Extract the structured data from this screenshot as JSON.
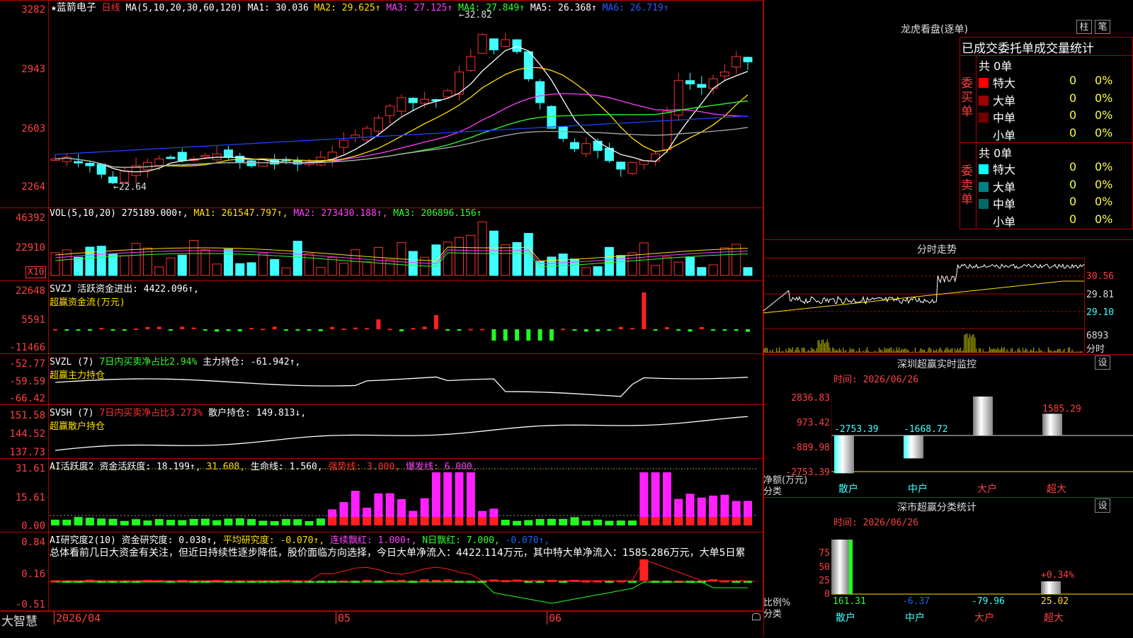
{
  "stock": {
    "star": "★",
    "name": "蓝箭电子",
    "period": "日线"
  },
  "main": {
    "ylabels": [
      "3282",
      "2943",
      "2603",
      "2264"
    ],
    "ma_header": {
      "params": "MA(5,10,20,30,60,120)",
      "ma1": "MA1: 30.036",
      "ma2": "MA2: 29.625↑",
      "ma3": "MA3: 27.125↑",
      "ma4": "MA4: 27.849↑",
      "ma5": "MA5: 26.368↑",
      "ma6": "MA6: 26.719↑"
    },
    "high_label": "32.82",
    "low_label": "22.64"
  },
  "vol": {
    "ylabels": [
      "46392",
      "22910"
    ],
    "unit": "X10",
    "header": {
      "p": "VOL(5,10,20)",
      "v": "275189.000↑,",
      "ma1": "MA1: 261547.797↑,",
      "ma2": "MA2: 273430.188↑,",
      "ma3": "MA3: 206896.156↑"
    }
  },
  "svzj": {
    "ylabels": [
      "22648",
      "5591",
      "-11466"
    ],
    "line1": "SVZJ  活跃资金进出: 4422.096↑,",
    "line2": "超赢资金流(万元)"
  },
  "svzl": {
    "ylabels": [
      "-52.77",
      "-59.59",
      "-66.42"
    ],
    "line1a": "SVZL (7)",
    "line1b": "7日内买卖净占比2.94%",
    "line1c": "主力持仓: -61.942↑,",
    "line2": "超赢主力持仓"
  },
  "svsh": {
    "ylabels": [
      "151.58",
      "144.52",
      "137.73"
    ],
    "line1a": "SVSH (7)",
    "line1b": "7日内买卖净占比3.273%",
    "line1c": "散户持仓: 149.813↓,",
    "line2": "超赢散户持仓"
  },
  "ai1": {
    "ylabels": [
      "31.61",
      "15.61",
      "0.00"
    ],
    "a": "AI活跃度2",
    "b": "资金活跃度: 18.199↑,",
    "c": "31.608,",
    "d": "生命线: 1.560,",
    "e": "强势线: 3.000,",
    "f": "爆发线: 6.000,"
  },
  "ai2": {
    "ylabels": [
      "0.84",
      "0.16",
      "-0.51"
    ],
    "a": "AI研究度2(10)",
    "b": "资金研究度: 0.038↑,",
    "c": "平均研究度: -0.070↑,",
    "d": "连续飘红: 1.000↑,",
    "e": "N日飘红: 7.000,",
    "f": "-0.070↑,",
    "summary": "总体看前几日大资金有关注，但近日持续性逐步降低，股价面临方向选择，今日大单净流入：4422.114万元，其中特大单净流入：1585.286万元，大单5日累"
  },
  "xaxis": {
    "start": "2026/04",
    "m05": "05",
    "m06": "06"
  },
  "brand": "大智慧",
  "right": {
    "lhb_title": "龙虎看盘(逐单)",
    "btn_zhu": "柱",
    "btn_bi": "笔",
    "stat_title": "已成交委托单成交量统计",
    "buy": {
      "vlabel": "委买单",
      "total": "共 0单",
      "rows": [
        {
          "name": "特大",
          "v": "0",
          "p": "0%",
          "color": "#ff0000"
        },
        {
          "name": "大单",
          "v": "0",
          "p": "0%",
          "color": "#a00000"
        },
        {
          "name": "中单",
          "v": "0",
          "p": "0%",
          "color": "#700000"
        },
        {
          "name": "小单",
          "v": "0",
          "p": "0%",
          "color": "#000000"
        }
      ]
    },
    "sell": {
      "vlabel": "委卖单",
      "total": "共 0单",
      "rows": [
        {
          "name": "特大",
          "v": "0",
          "p": "0%",
          "color": "#00ffff"
        },
        {
          "name": "大单",
          "v": "0",
          "p": "0%",
          "color": "#008080"
        },
        {
          "name": "中单",
          "v": "0",
          "p": "0%",
          "color": "#006868"
        },
        {
          "name": "小单",
          "v": "0",
          "p": "0%",
          "color": "#000000"
        }
      ]
    },
    "fenshi": {
      "title": "分时走势",
      "y1": "30.56",
      "y2": "29.81",
      "y3": "29.10",
      "vol": "6893",
      "unit": "分时"
    },
    "monitor": {
      "title": "深圳超赢实时监控",
      "set": "设",
      "time": "时间: 2026/06/26",
      "ylabels": [
        "2836.83",
        "973.42",
        "-889.98",
        "-2753.39"
      ],
      "label_net": "净额(万元)",
      "label_cat": "分类",
      "bars": [
        {
          "name": "散户",
          "value": "-2753.39"
        },
        {
          "name": "中户",
          "value": "-1668.72"
        },
        {
          "name": "大户",
          "value": "2836.83"
        },
        {
          "name": "超大",
          "value": "1585.29"
        }
      ]
    },
    "classify": {
      "title": "深市超赢分类统计",
      "set": "设",
      "time": "时间: 2026/06/26",
      "ylabels": [
        "75",
        "50",
        "25",
        "0"
      ],
      "label_ratio": "比例%",
      "label_cat": "分类",
      "vals": [
        "161.31",
        "-6.37",
        "-79.96",
        "25.02"
      ],
      "extra": "+0.34%",
      "cats": [
        "散户",
        "中户",
        "大户",
        "超大"
      ]
    }
  }
}
